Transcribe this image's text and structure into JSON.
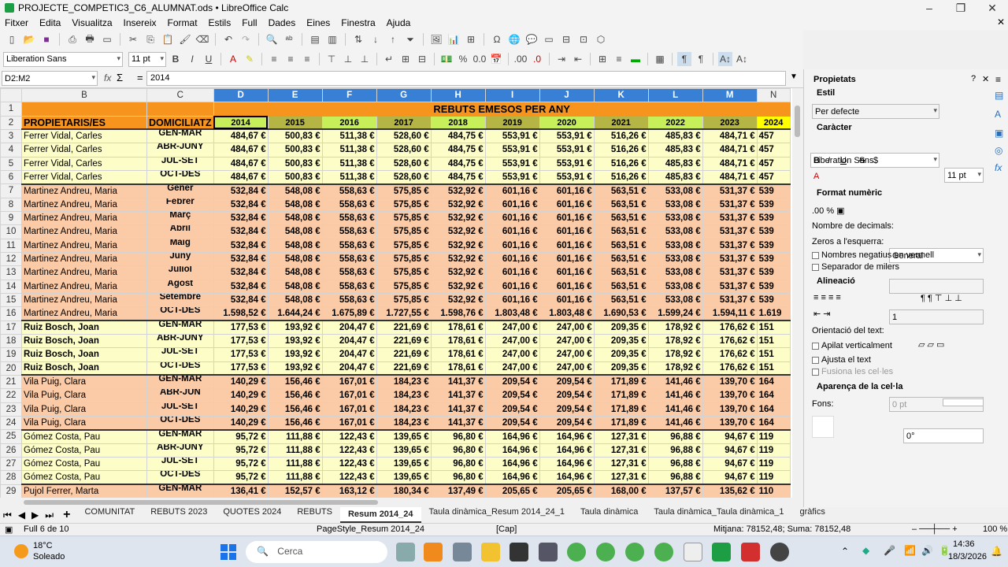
{
  "window": {
    "title": "PROJECTE_COMPETIC3_C6_ALUMNAT.ods • LibreOffice Calc"
  },
  "menu": [
    "Fitxer",
    "Edita",
    "Visualitza",
    "Insereix",
    "Format",
    "Estils",
    "Full",
    "Dades",
    "Eines",
    "Finestra",
    "Ajuda"
  ],
  "toolbar": {
    "font_name": "Liberation Sans",
    "font_size": "11 pt"
  },
  "formula_bar": {
    "name_box": "D2:M2",
    "content": "2014",
    "sigma": "Σ",
    "equals": "="
  },
  "columns": [
    "B",
    "C",
    "D",
    "E",
    "F",
    "G",
    "H",
    "I",
    "J",
    "K",
    "L",
    "M",
    "N"
  ],
  "header_row": {
    "title": "REBUTS EMESOS PER ANY",
    "owner_label": "PROPIETARIS/ES",
    "domicile_label": "DOMICILIATZ",
    "years": [
      "2014",
      "2015",
      "2016",
      "2017",
      "2018",
      "2019",
      "2020",
      "2021",
      "2022",
      "2023",
      "2024"
    ]
  },
  "groups": [
    {
      "name": "Ferrer Vidal, Carles",
      "bold": false,
      "bg": "#fdfdc8",
      "periods": [
        "GEN-MAR",
        "ABR-JUNY",
        "JUL-SET",
        "OCT-DES"
      ],
      "values": [
        "484,67 €",
        "500,83 €",
        "511,38 €",
        "528,60 €",
        "484,75 €",
        "553,91 €",
        "553,91 €",
        "516,26 €",
        "485,83 €",
        "484,71 €",
        "457"
      ],
      "last": null
    },
    {
      "name": "Martinez Andreu, Maria",
      "bold": false,
      "bg": "#fbcaa6",
      "periods": [
        "Gener",
        "Febrer",
        "Març",
        "Abril",
        "Maig",
        "Juny",
        "Juliol",
        "Agost",
        "Setembre"
      ],
      "values": [
        "532,84 €",
        "548,08 €",
        "558,63 €",
        "575,85 €",
        "532,92 €",
        "601,16 €",
        "601,16 €",
        "563,51 €",
        "533,08 €",
        "531,37 €",
        "539"
      ],
      "last": {
        "period": "OCT-DES",
        "values": [
          "1.598,52 €",
          "1.644,24 €",
          "1.675,89 €",
          "1.727,55 €",
          "1.598,76 €",
          "1.803,48 €",
          "1.803,48 €",
          "1.690,53 €",
          "1.599,24 €",
          "1.594,11 €",
          "1.619"
        ]
      }
    },
    {
      "name": "Ruiz Bosch, Joan",
      "bold": true,
      "bg": "#fdfdc8",
      "periods": [
        "GEN-MAR",
        "ABR-JUNY",
        "JUL-SET",
        "OCT-DES"
      ],
      "values": [
        "177,53 €",
        "193,92 €",
        "204,47 €",
        "221,69 €",
        "178,61 €",
        "247,00 €",
        "247,00 €",
        "209,35 €",
        "178,92 €",
        "176,62 €",
        "151"
      ],
      "last": null
    },
    {
      "name": "Vila Puig, Clara",
      "bold": false,
      "bg": "#fbcaa6",
      "periods": [
        "GEN-MAR",
        "ABR-JUN",
        "JUL-SET",
        "OCT-DES"
      ],
      "values": [
        "140,29 €",
        "156,46 €",
        "167,01 €",
        "184,23 €",
        "141,37 €",
        "209,54 €",
        "209,54 €",
        "171,89 €",
        "141,46 €",
        "139,70 €",
        "164"
      ],
      "last": null
    },
    {
      "name": "Gómez Costa, Pau",
      "bold": false,
      "bg": "#fdfdc8",
      "periods": [
        "GEN-MAR",
        "ABR-JUNY",
        "JUL-SET",
        "OCT-DES"
      ],
      "values": [
        "95,72 €",
        "111,88 €",
        "122,43 €",
        "139,65 €",
        "96,80 €",
        "164,96 €",
        "164,96 €",
        "127,31 €",
        "96,88 €",
        "94,67 €",
        "119"
      ],
      "last": null
    },
    {
      "name": "Pujol Ferrer, Marta",
      "bold": false,
      "bg": "#fbcaa6",
      "periods": [
        "GEN-MAR"
      ],
      "values": [
        "136,41 €",
        "152,57 €",
        "163,12 €",
        "180,34 €",
        "137,49 €",
        "205,65 €",
        "205,65 €",
        "168,00 €",
        "137,57 €",
        "135,62 €",
        "110"
      ],
      "last": null
    }
  ],
  "sidebar": {
    "title": "Propietats",
    "style_section": "Estil",
    "style_value": "Per defecte",
    "char_section": "Caràcter",
    "char_font": "Liberation Sans",
    "char_size": "11 pt",
    "num_section": "Format numèric",
    "num_format": "General",
    "decimals_label": "Nombre de decimals:",
    "leading_zeros_label": "Zeros a l'esquerra:",
    "leading_zeros_value": "1",
    "neg_red_label": "Nombres negatius en vermell",
    "thousands_label": "Separador de milers",
    "align_section": "Alineació",
    "indent_value": "0 pt",
    "orientation_label": "Orientació del text:",
    "orientation_value": "0°",
    "stack_label": "Apilat verticalment",
    "wrap_label": "Ajusta el text",
    "merge_label": "Fusiona les cel·les",
    "appearance_section": "Aparença de la cel·la",
    "bg_label": "Fons:"
  },
  "tabs": [
    "COMUNITAT",
    "REBUTS 2023",
    "QUOTES 2024",
    "REBUTS",
    "Resum 2014_24",
    "Taula dinàmica_Resum 2014_24_1",
    "Taula dinàmica",
    "Taula dinàmica_Taula dinàmica_1",
    "gràfics"
  ],
  "active_tab": "Resum 2014_24",
  "status": {
    "sheet": "Full 6 de 10",
    "page_style": "PageStyle_Resum 2014_24",
    "caps": "[Cap]",
    "summary": "Mitjana: 78152,48; Suma: 78152,48",
    "zoom": "100 %"
  },
  "taskbar": {
    "temp": "18°C",
    "weather": "Soleado",
    "search": "Cerca",
    "time": "14:36",
    "date": "18/3/2026"
  },
  "colors": {
    "orange_header": "#f7941d",
    "selection": "#3880d6",
    "yellow_band": "#fdfdc8",
    "peach_band": "#fbcaa6",
    "year_green": "#c6ef5a",
    "year_olive": "#b5b545"
  }
}
